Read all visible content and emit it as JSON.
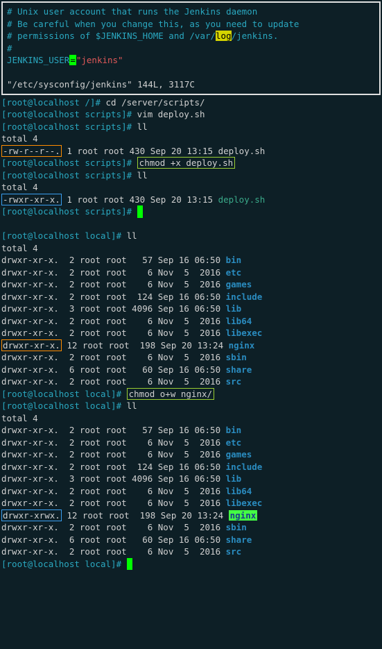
{
  "editor": {
    "c1": "# Unix user account that runs the Jenkins daemon",
    "c2": "# Be careful when you change this, as you need to update",
    "c3a": "# permissions of $JENKINS_HOME and /var/",
    "c3_hl": "log",
    "c3b": "/jenkins.",
    "c4": "#",
    "var": "JENKINS_USER",
    "eq": "=",
    "val": "\"jenkins\"",
    "status": "\"/etc/sysconfig/jenkins\" 144L, 3117C"
  },
  "block1": {
    "l1_prompt": "[root@localhost /]# ",
    "l1_cmd": "cd /server/scripts/",
    "l2_prompt": "[root@localhost scripts]# ",
    "l2_cmd": "vim deploy.sh",
    "l3_prompt": "[root@localhost scripts]# ",
    "l3_cmd": "ll",
    "l4": "total 4",
    "l5_perm": "-rw-r--r--.",
    "l5_rest": " 1 root root 430 Sep 20 13:15 deploy.sh",
    "l6_prompt": "[root@localhost scripts]# ",
    "l6_cmd": "chmod +x deploy.sh",
    "l7_prompt": "[root@localhost scripts]# ",
    "l7_cmd": "ll",
    "l8": "total 4",
    "l9_perm": "-rwxr-xr-x.",
    "l9_rest": " 1 root root 430 Sep 20 13:15 ",
    "l9_file": "deploy.sh",
    "l10_prompt": "[root@localhost scripts]# "
  },
  "block2": {
    "l1_prompt": "[root@localhost local]# ",
    "l1_cmd": "ll",
    "l2": "total 4",
    "rows": [
      {
        "perm": "drwxr-xr-x.",
        "links": "  2",
        "rest": " root root   57 Sep 16 06:50 ",
        "name": "bin"
      },
      {
        "perm": "drwxr-xr-x.",
        "links": "  2",
        "rest": " root root    6 Nov  5  2016 ",
        "name": "etc"
      },
      {
        "perm": "drwxr-xr-x.",
        "links": "  2",
        "rest": " root root    6 Nov  5  2016 ",
        "name": "games"
      },
      {
        "perm": "drwxr-xr-x.",
        "links": "  2",
        "rest": " root root  124 Sep 16 06:50 ",
        "name": "include"
      },
      {
        "perm": "drwxr-xr-x.",
        "links": "  3",
        "rest": " root root 4096 Sep 16 06:50 ",
        "name": "lib"
      },
      {
        "perm": "drwxr-xr-x.",
        "links": "  2",
        "rest": " root root    6 Nov  5  2016 ",
        "name": "lib64"
      },
      {
        "perm": "drwxr-xr-x.",
        "links": "  2",
        "rest": " root root    6 Nov  5  2016 ",
        "name": "libexec"
      },
      {
        "perm": "drwxr-xr-x.",
        "links": " 12",
        "rest": " root root  198 Sep 20 13:24 ",
        "name": "nginx",
        "boxed": "orange"
      },
      {
        "perm": "drwxr-xr-x.",
        "links": "  2",
        "rest": " root root    6 Nov  5  2016 ",
        "name": "sbin"
      },
      {
        "perm": "drwxr-xr-x.",
        "links": "  6",
        "rest": " root root   60 Sep 16 06:50 ",
        "name": "share"
      },
      {
        "perm": "drwxr-xr-x.",
        "links": "  2",
        "rest": " root root    6 Nov  5  2016 ",
        "name": "src"
      }
    ],
    "chmod_prompt": "[root@localhost local]# ",
    "chmod_cmd": "chmod o+w nginx/",
    "ll2_prompt": "[root@localhost local]# ",
    "ll2_cmd": "ll",
    "l_total2": "total 4",
    "rows2": [
      {
        "perm": "drwxr-xr-x.",
        "links": "  2",
        "rest": " root root   57 Sep 16 06:50 ",
        "name": "bin"
      },
      {
        "perm": "drwxr-xr-x.",
        "links": "  2",
        "rest": " root root    6 Nov  5  2016 ",
        "name": "etc"
      },
      {
        "perm": "drwxr-xr-x.",
        "links": "  2",
        "rest": " root root    6 Nov  5  2016 ",
        "name": "games"
      },
      {
        "perm": "drwxr-xr-x.",
        "links": "  2",
        "rest": " root root  124 Sep 16 06:50 ",
        "name": "include"
      },
      {
        "perm": "drwxr-xr-x.",
        "links": "  3",
        "rest": " root root 4096 Sep 16 06:50 ",
        "name": "lib"
      },
      {
        "perm": "drwxr-xr-x.",
        "links": "  2",
        "rest": " root root    6 Nov  5  2016 ",
        "name": "lib64"
      },
      {
        "perm": "drwxr-xr-x.",
        "links": "  2",
        "rest": " root root    6 Nov  5  2016 ",
        "name": "libexec"
      },
      {
        "perm": "drwxr-xrwx.",
        "links": " 12",
        "rest": " root root  198 Sep 20 13:24 ",
        "name": "nginx",
        "boxed": "blue",
        "hl": true
      },
      {
        "perm": "drwxr-xr-x.",
        "links": "  2",
        "rest": " root root    6 Nov  5  2016 ",
        "name": "sbin"
      },
      {
        "perm": "drwxr-xr-x.",
        "links": "  6",
        "rest": " root root   60 Sep 16 06:50 ",
        "name": "share"
      },
      {
        "perm": "drwxr-xr-x.",
        "links": "  2",
        "rest": " root root    6 Nov  5  2016 ",
        "name": "src"
      }
    ],
    "final_prompt": "[root@localhost local]# "
  }
}
